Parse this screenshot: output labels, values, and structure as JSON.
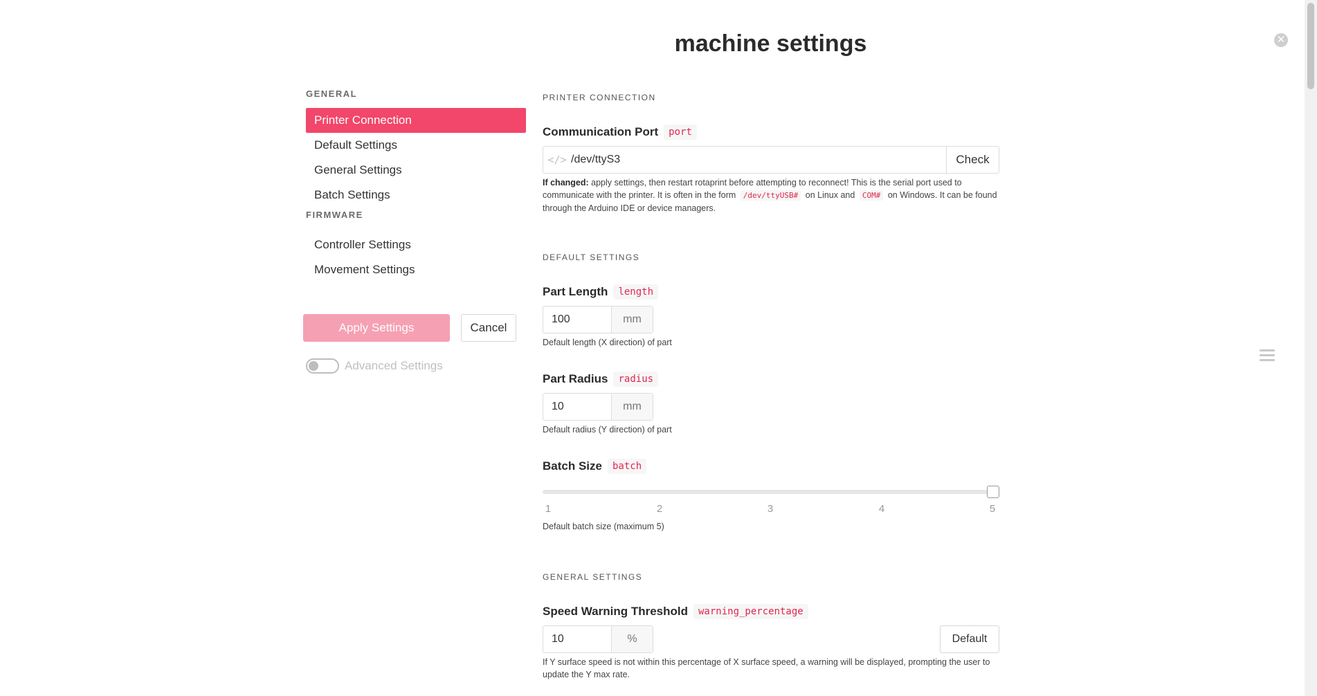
{
  "page": {
    "title": "machine settings"
  },
  "sidebar": {
    "general_heading": "GENERAL",
    "general_items": [
      "Printer Connection",
      "Default Settings",
      "General Settings",
      "Batch Settings"
    ],
    "firmware_heading": "FIRMWARE",
    "firmware_items": [
      "Controller Settings",
      "Movement Settings"
    ],
    "apply_label": "Apply Settings",
    "cancel_label": "Cancel",
    "advanced_label": "Advanced Settings",
    "advanced_enabled": false
  },
  "printer_connection": {
    "heading": "PRINTER CONNECTION",
    "port": {
      "label": "Communication Port",
      "key": "port",
      "value": "/dev/ttyS3",
      "check_label": "Check",
      "help_bold": "If changed:",
      "help_part1": " apply settings, then restart rotaprint before attempting to reconnect! This is the serial port used to communicate with the printer. It is often in the form",
      "help_code1": "/dev/ttyUSB#",
      "help_part2": "on Linux and",
      "help_code2": "COM#",
      "help_part3": "on Windows. It can be found through the Arduino IDE or device managers."
    }
  },
  "default_settings": {
    "heading": "DEFAULT SETTINGS",
    "length": {
      "label": "Part Length",
      "key": "length",
      "value": "100",
      "unit": "mm",
      "help": "Default length (X direction) of part"
    },
    "radius": {
      "label": "Part Radius",
      "key": "radius",
      "value": "10",
      "unit": "mm",
      "help": "Default radius (Y direction) of part"
    },
    "batch": {
      "label": "Batch Size",
      "key": "batch",
      "value": 5,
      "min": 1,
      "max": 5,
      "ticks": [
        "1",
        "2",
        "3",
        "4",
        "5"
      ],
      "help": "Default batch size (maximum 5)"
    }
  },
  "general_settings": {
    "heading": "GENERAL SETTINGS",
    "warning": {
      "label": "Speed Warning Threshold",
      "key": "warning_percentage",
      "value": "10",
      "unit": "%",
      "default_label": "Default",
      "help": "If Y surface speed is not within this percentage of X surface speed, a warning will be displayed, prompting the user to update the Y max rate."
    }
  },
  "colors": {
    "accent": "#f2466a",
    "accent_disabled": "#f6a0b3",
    "code": "#e0284f"
  }
}
